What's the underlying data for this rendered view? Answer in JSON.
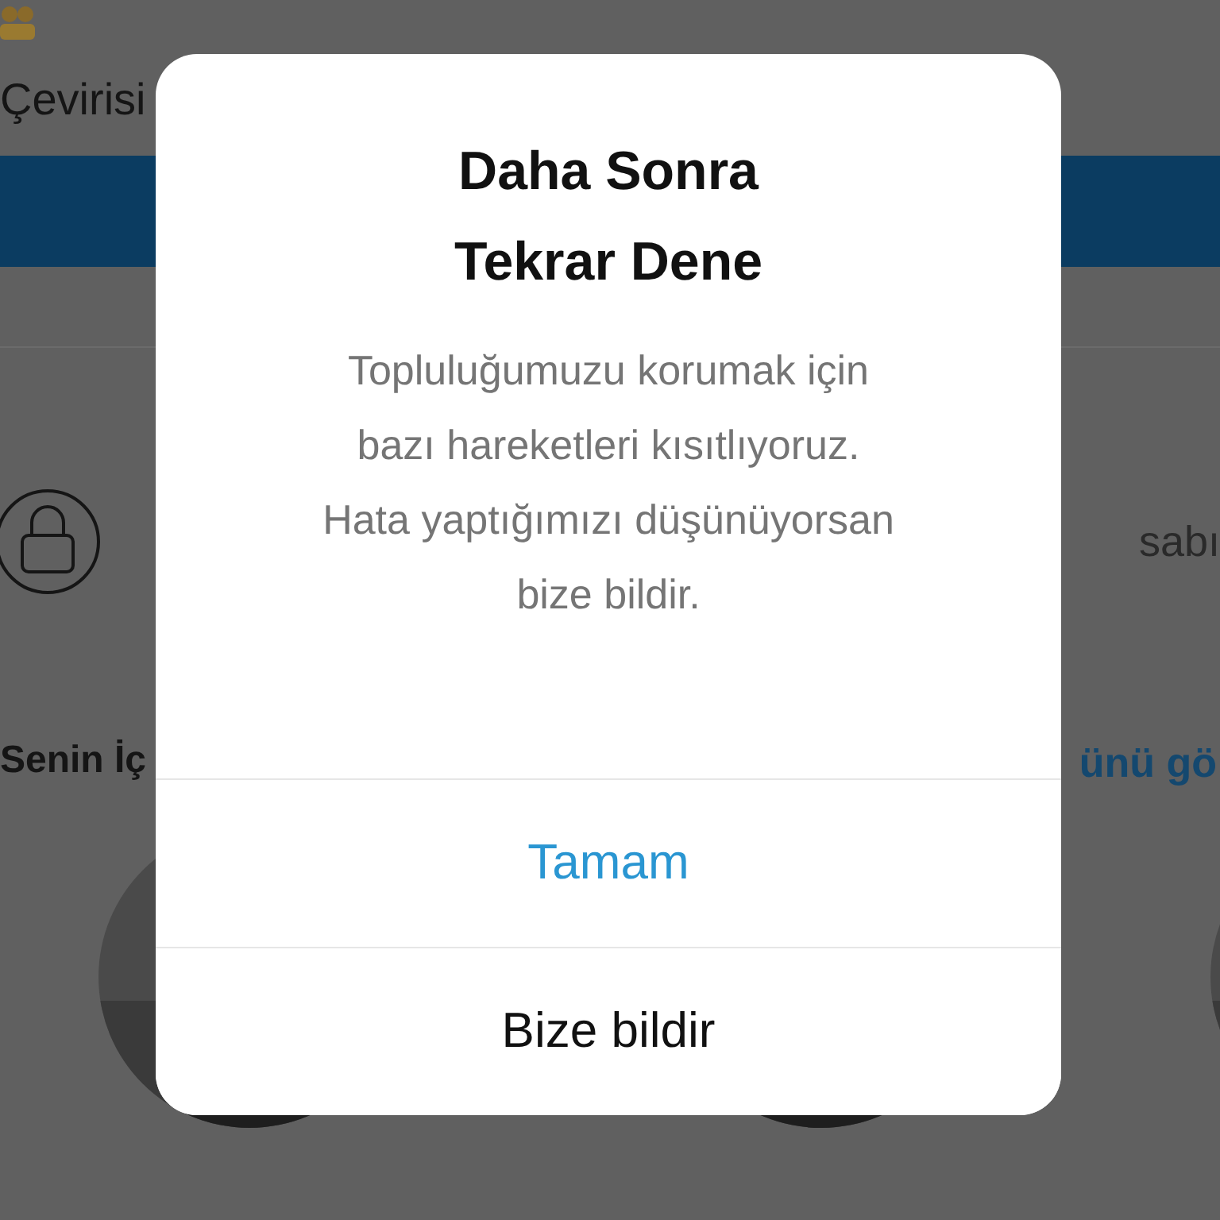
{
  "background": {
    "header_text": "Çevirisi",
    "locked_text": "sabı",
    "section_title": "Senin İç",
    "section_link": "ünü gö"
  },
  "dialog": {
    "title": "Daha Sonra\nTekrar Dene",
    "message": "Topluluğumuzu korumak için\nbazı hareketleri kısıtlıyoruz.\nHata yaptığımızı düşünüyorsan\nbize bildir.",
    "buttons": [
      {
        "label": "Tamam",
        "kind": "primary"
      },
      {
        "label": "Bize bildir",
        "kind": "default"
      }
    ]
  }
}
